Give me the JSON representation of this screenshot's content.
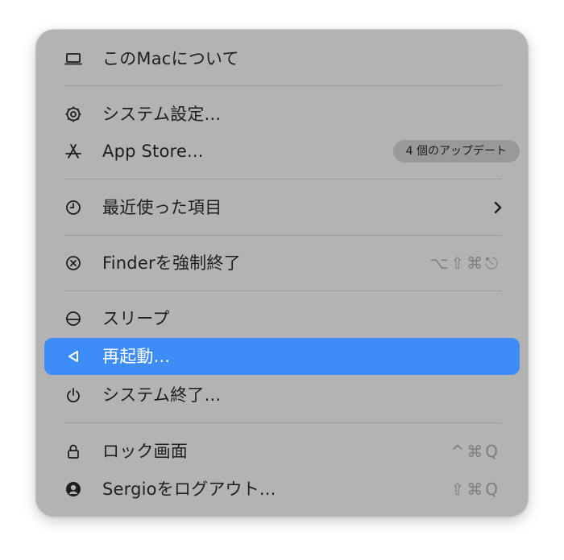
{
  "menu": {
    "items": [
      {
        "label": "このMacについて",
        "icon": "laptop-icon"
      },
      {
        "label": "システム設定...",
        "icon": "gear-icon"
      },
      {
        "label": "App Store...",
        "icon": "app-store-icon",
        "badge": "4 個のアップデート"
      },
      {
        "label": "最近使った項目",
        "icon": "clock-icon",
        "submenu": true
      },
      {
        "label": "Finderを強制終了",
        "icon": "force-quit-icon",
        "shortcut": "⌥⇧⌘⎋"
      },
      {
        "label": "スリープ",
        "icon": "sleep-icon"
      },
      {
        "label": "再起動...",
        "icon": "restart-icon",
        "highlighted": true
      },
      {
        "label": "システム終了...",
        "icon": "power-icon"
      },
      {
        "label": "ロック画面",
        "icon": "lock-icon",
        "shortcut": "^⌘Q"
      },
      {
        "label": "Sergioをログアウト...",
        "icon": "user-icon",
        "shortcut": "⇧⌘Q"
      }
    ]
  },
  "colors": {
    "menu_background": "#b3b3b3",
    "highlight": "#3d8cf7",
    "text": "#1e1e1e",
    "shortcut_text": "#7d7d7d",
    "badge_background": "#999999"
  }
}
